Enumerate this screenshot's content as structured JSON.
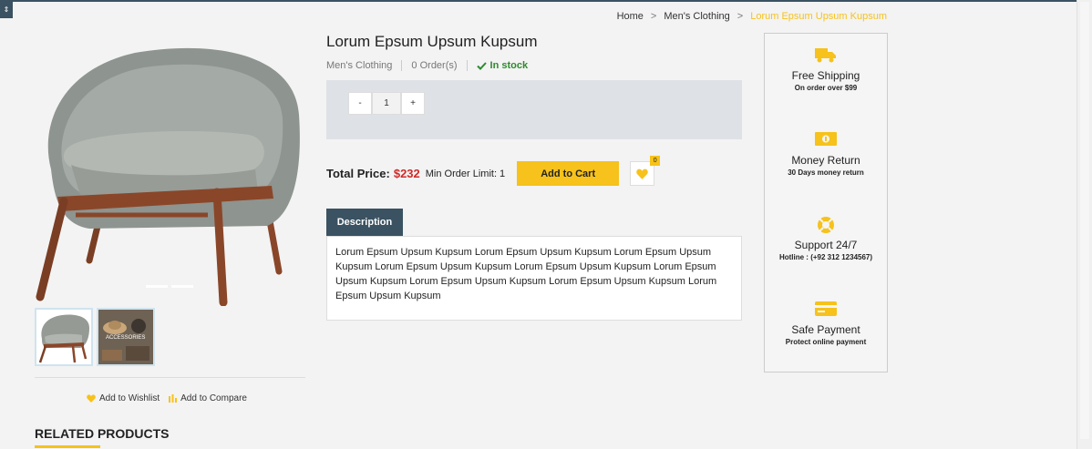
{
  "breadcrumb": {
    "home": "Home",
    "sep1": ">",
    "category": "Men's Clothing",
    "sep2": ">",
    "current": "Lorum Epsum Upsum Kupsum"
  },
  "product": {
    "title": "Lorum Epsum Upsum Kupsum",
    "category": "Men's Clothing",
    "orders": "0 Order(s)",
    "stock": "In stock",
    "quantity": {
      "minus": "-",
      "value": "1",
      "plus": "+"
    },
    "price_label": "Total Price:",
    "price": "$232",
    "min_order": "Min Order Limit: 1",
    "add_to_cart": "Add to Cart",
    "wishlist_count": "0",
    "description_tab": "Description",
    "description": "Lorum Epsum Upsum Kupsum Lorum Epsum Upsum Kupsum Lorum Epsum Upsum Kupsum Lorum Epsum Upsum Kupsum Lorum Epsum Upsum Kupsum Lorum Epsum Upsum Kupsum Lorum Epsum Upsum Kupsum Lorum Epsum Upsum Kupsum Lorum Epsum Upsum Kupsum"
  },
  "gallery": {
    "thumb2_text": "ACCESSORIES",
    "add_to_wishlist": "Add to Wishlist",
    "add_to_compare": "Add to Compare"
  },
  "related": {
    "title": "RELATED PRODUCTS"
  },
  "features": [
    {
      "icon": "truck-icon",
      "title": "Free Shipping",
      "subtitle": "On order over $99"
    },
    {
      "icon": "money-icon",
      "title": "Money Return",
      "subtitle": "30 Days money return"
    },
    {
      "icon": "lifebuoy-icon",
      "title": "Support 24/7",
      "subtitle": "Hotline : (+92 312 1234567)"
    },
    {
      "icon": "credit-card-icon",
      "title": "Safe Payment",
      "subtitle": "Protect online payment"
    }
  ],
  "colors": {
    "accent": "#f6c21b",
    "dark": "#3a5261",
    "price": "#d02a2a",
    "stock": "#2e8b2e"
  }
}
